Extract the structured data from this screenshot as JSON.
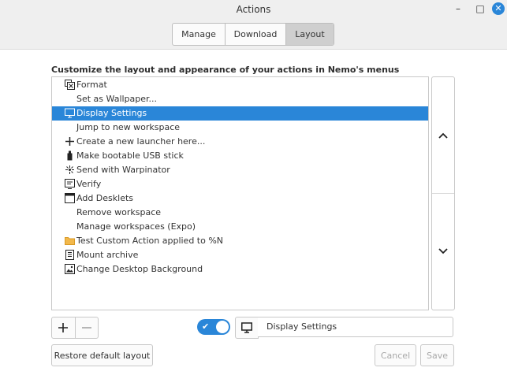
{
  "window": {
    "title": "Actions",
    "controls": {
      "minimize": "–",
      "maximize": "□",
      "close": "✕"
    }
  },
  "tabs": [
    {
      "label": "Manage",
      "active": false
    },
    {
      "label": "Download",
      "active": false
    },
    {
      "label": "Layout",
      "active": true
    }
  ],
  "heading": "Customize the layout and appearance of your actions in Nemo's menus",
  "list": {
    "items": [
      {
        "label": "Format",
        "icon": "format-icon",
        "selected": false
      },
      {
        "label": "Set as Wallpaper...",
        "icon": "",
        "selected": false
      },
      {
        "label": "Display Settings",
        "icon": "monitor-icon",
        "selected": true
      },
      {
        "label": "Jump to new workspace",
        "icon": "",
        "selected": false
      },
      {
        "label": "Create a new launcher here...",
        "icon": "plus-icon",
        "selected": false
      },
      {
        "label": "Make bootable USB stick",
        "icon": "usb-stick-icon",
        "selected": false
      },
      {
        "label": "Send with Warpinator",
        "icon": "warpinator-icon",
        "selected": false
      },
      {
        "label": "Verify",
        "icon": "verify-icon",
        "selected": false
      },
      {
        "label": "Add Desklets",
        "icon": "desklet-icon",
        "selected": false
      },
      {
        "label": "Remove workspace",
        "icon": "",
        "selected": false
      },
      {
        "label": "Manage workspaces (Expo)",
        "icon": "",
        "selected": false
      },
      {
        "label": "Test Custom Action applied to %N",
        "icon": "folder-icon",
        "selected": false
      },
      {
        "label": "Mount archive",
        "icon": "archive-icon",
        "selected": false
      },
      {
        "label": "Change Desktop Background",
        "icon": "image-icon",
        "selected": false
      }
    ]
  },
  "controls": {
    "add_icon": "plus-icon",
    "remove_icon": "minus-icon",
    "toggle_enabled": true,
    "selected_icon": "monitor-icon",
    "selected_name": "Display Settings"
  },
  "buttons": {
    "restore": "Restore default layout",
    "cancel": "Cancel",
    "save": "Save"
  },
  "colors": {
    "accent": "#2a86d8",
    "selected_text": "#ffffff",
    "disabled_text": "#a8a8a8"
  }
}
